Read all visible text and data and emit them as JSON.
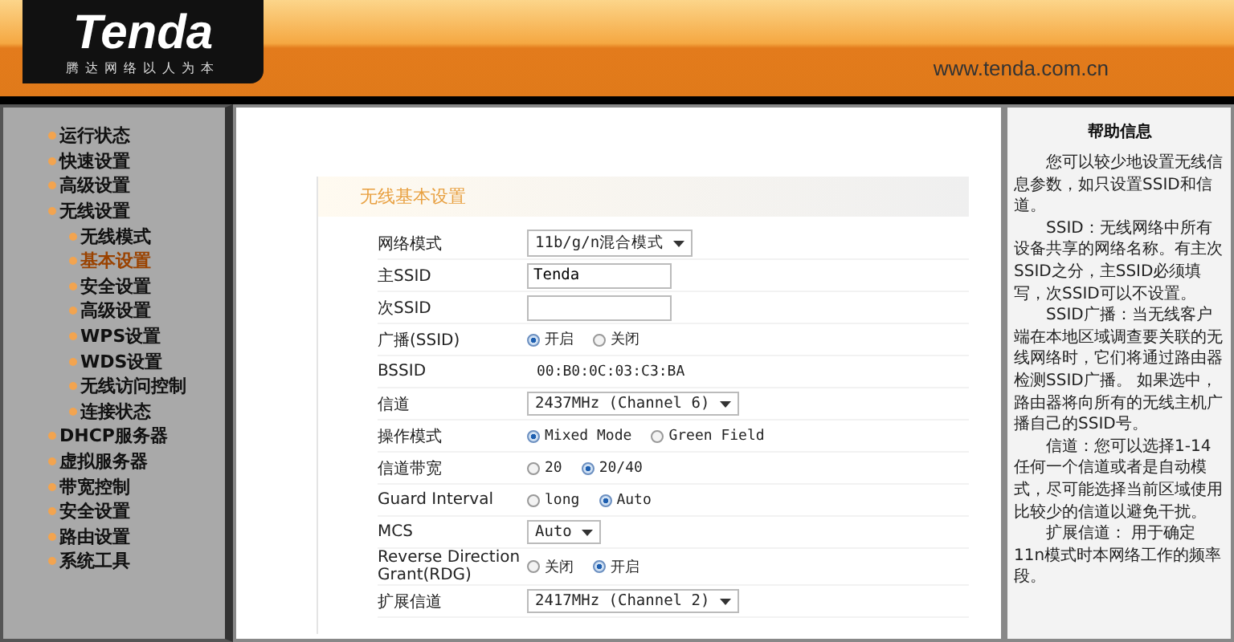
{
  "header": {
    "logo": "Tenda",
    "slogan": "腾达网络以人为本",
    "url": "www.tenda.com.cn"
  },
  "sidebar": {
    "items": [
      {
        "label": "运行状态",
        "selected": false
      },
      {
        "label": "快速设置",
        "selected": false
      },
      {
        "label": "高级设置",
        "selected": false
      },
      {
        "label": "无线设置",
        "selected": false,
        "children": [
          {
            "label": "无线模式",
            "selected": false
          },
          {
            "label": "基本设置",
            "selected": true
          },
          {
            "label": "安全设置",
            "selected": false
          },
          {
            "label": "高级设置",
            "selected": false
          },
          {
            "label": "WPS设置",
            "selected": false
          },
          {
            "label": "WDS设置",
            "selected": false
          },
          {
            "label": "无线访问控制",
            "selected": false
          },
          {
            "label": "连接状态",
            "selected": false
          }
        ]
      },
      {
        "label": "DHCP服务器",
        "selected": false
      },
      {
        "label": "虚拟服务器",
        "selected": false
      },
      {
        "label": "带宽控制",
        "selected": false
      },
      {
        "label": "安全设置",
        "selected": false
      },
      {
        "label": "路由设置",
        "selected": false
      },
      {
        "label": "系统工具",
        "selected": false
      }
    ]
  },
  "form": {
    "title": "无线基本设置",
    "rows": [
      {
        "kind": "select",
        "label": "网络模式",
        "value": "11b/g/n混合模式"
      },
      {
        "kind": "text",
        "label": "主SSID",
        "value": "Tenda"
      },
      {
        "kind": "text",
        "label": "次SSID",
        "value": ""
      },
      {
        "kind": "radio",
        "label": "广播(SSID)",
        "options": [
          {
            "label": "开启",
            "selected": true
          },
          {
            "label": "关闭",
            "selected": false
          }
        ]
      },
      {
        "kind": "static",
        "label": "BSSID",
        "value": "00:B0:0C:03:C3:BA"
      },
      {
        "kind": "select",
        "label": "信道",
        "value": "2437MHz (Channel 6)"
      },
      {
        "kind": "radio",
        "label": "操作模式",
        "options": [
          {
            "label": "Mixed Mode",
            "selected": true
          },
          {
            "label": "Green Field",
            "selected": false
          }
        ]
      },
      {
        "kind": "radio",
        "label": "信道带宽",
        "options": [
          {
            "label": "20",
            "selected": false
          },
          {
            "label": "20/40",
            "selected": true
          }
        ]
      },
      {
        "kind": "radio",
        "label": "Guard Interval",
        "options": [
          {
            "label": "long",
            "selected": false
          },
          {
            "label": "Auto",
            "selected": true
          }
        ]
      },
      {
        "kind": "select",
        "label": "MCS",
        "value": "Auto"
      },
      {
        "kind": "radio",
        "label": "Reverse Direction Grant(RDG)",
        "options": [
          {
            "label": "关闭",
            "selected": false
          },
          {
            "label": "开启",
            "selected": true
          }
        ]
      },
      {
        "kind": "select",
        "label": "扩展信道",
        "value": "2417MHz (Channel 2)"
      }
    ]
  },
  "help": {
    "title": "帮助信息",
    "paragraphs": [
      "您可以较少地设置无线信息参数，如只设置SSID和信道。",
      "SSID：无线网络中所有设备共享的网络名称。有主次SSID之分，主SSID必须填写，次SSID可以不设置。",
      "SSID广播：当无线客户端在本地区域调查要关联的无线网络时，它们将通过路由器检测SSID广播。 如果选中，路由器将向所有的无线主机广播自己的SSID号。",
      "信道：您可以选择1-14任何一个信道或者是自动模式，尽可能选择当前区域使用比较少的信道以避免干扰。",
      "扩展信道： 用于确定11n模式时本网络工作的频率段。"
    ]
  }
}
